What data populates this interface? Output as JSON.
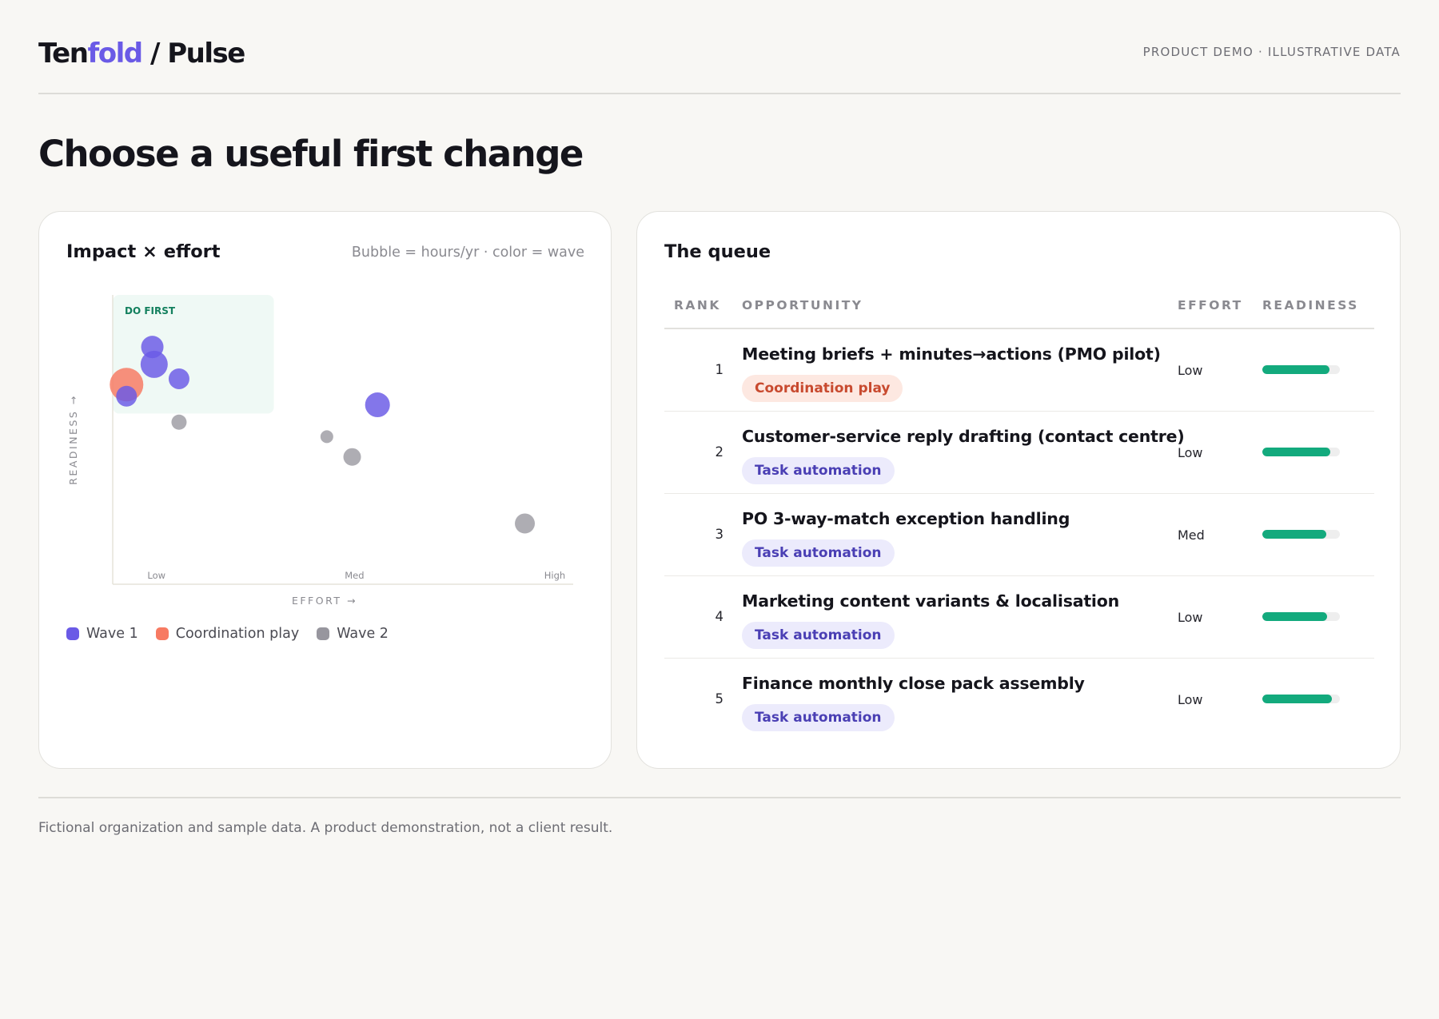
{
  "header": {
    "brand_part1": "Ten",
    "brand_part2": "fold",
    "brand_part3": " / Pulse",
    "demo_tag": "PRODUCT DEMO · ILLUSTRATIVE DATA"
  },
  "page_title": "Choose a useful first change",
  "impact_card": {
    "title": "Impact × effort",
    "note": "Bubble = hours/yr · color = wave"
  },
  "chart_data": {
    "type": "scatter",
    "title": "Impact × effort",
    "subtitle": "Bubble = hours/yr · color = wave",
    "xlabel": "EFFORT →",
    "ylabel": "READINESS →",
    "x_ticks": [
      "Low",
      "Med",
      "High"
    ],
    "x_scale": "relative 0–1 (Low→High)",
    "y_scale": "relative 0–1 (low→high)",
    "quadrant_label": "DO FIRST",
    "quadrant_range": {
      "x": [
        0,
        0.35
      ],
      "y": [
        0.59,
        1.0
      ]
    },
    "grid": false,
    "legend_position": "bottom-left",
    "series": [
      {
        "name": "Wave 1",
        "color": "#6a5ae6",
        "points": [
          {
            "x": 0.09,
            "y": 0.76,
            "size": 34
          },
          {
            "x": 0.086,
            "y": 0.82,
            "size": 28
          },
          {
            "x": 0.144,
            "y": 0.71,
            "size": 26
          },
          {
            "x": 0.03,
            "y": 0.65,
            "size": 26
          },
          {
            "x": 0.575,
            "y": 0.62,
            "size": 31
          }
        ]
      },
      {
        "name": "Coordination play",
        "color": "#f77a62",
        "points": [
          {
            "x": 0.03,
            "y": 0.69,
            "size": 42
          }
        ]
      },
      {
        "name": "Wave 2",
        "color": "#97969e",
        "points": [
          {
            "x": 0.144,
            "y": 0.56,
            "size": 19
          },
          {
            "x": 0.465,
            "y": 0.51,
            "size": 16
          },
          {
            "x": 0.52,
            "y": 0.44,
            "size": 22
          },
          {
            "x": 0.895,
            "y": 0.21,
            "size": 25
          }
        ]
      }
    ]
  },
  "legend": [
    {
      "label": "Wave 1",
      "color": "#6a5ae6"
    },
    {
      "label": "Coordination play",
      "color": "#f77a62"
    },
    {
      "label": "Wave 2",
      "color": "#97969e"
    }
  ],
  "queue": {
    "title": "The queue",
    "columns": {
      "rank": "RANK",
      "opportunity": "OPPORTUNITY",
      "effort": "EFFORT",
      "readiness": "READINESS"
    },
    "rows": [
      {
        "rank": "1",
        "title": "Meeting briefs + minutes→actions (PMO pilot)",
        "tag": "Coordination play",
        "tag_kind": "coord",
        "effort": "Low",
        "readiness": 0.87
      },
      {
        "rank": "2",
        "title": "Customer-service reply drafting (contact centre)",
        "tag": "Task automation",
        "tag_kind": "task",
        "effort": "Low",
        "readiness": 0.88
      },
      {
        "rank": "3",
        "title": "PO 3-way-match exception handling",
        "tag": "Task automation",
        "tag_kind": "task",
        "effort": "Med",
        "readiness": 0.82
      },
      {
        "rank": "4",
        "title": "Marketing content variants & localisation",
        "tag": "Task automation",
        "tag_kind": "task",
        "effort": "Low",
        "readiness": 0.84
      },
      {
        "rank": "5",
        "title": "Finance monthly close pack assembly",
        "tag": "Task automation",
        "tag_kind": "task",
        "effort": "Low",
        "readiness": 0.9
      }
    ]
  },
  "footer": {
    "note": "Fictional organization and sample data. A product demonstration, not a client result."
  }
}
